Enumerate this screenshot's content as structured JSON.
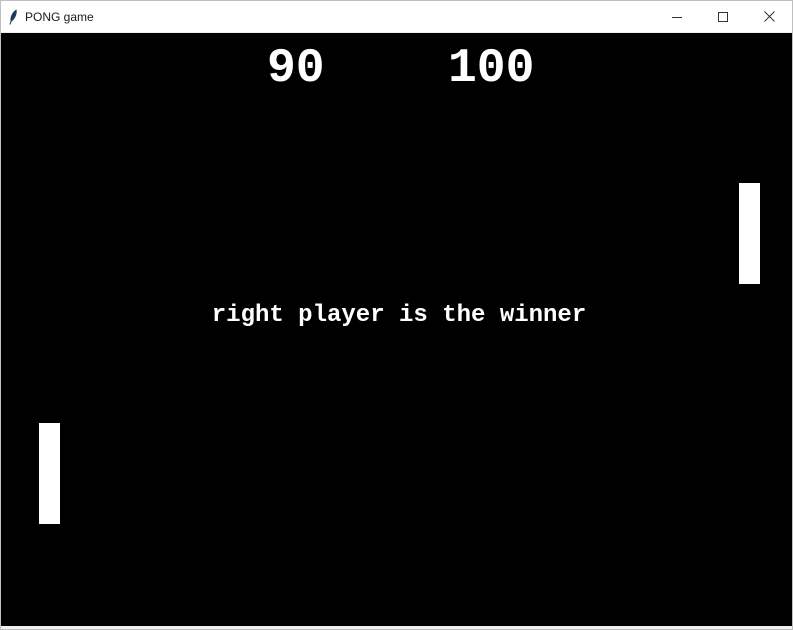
{
  "window": {
    "title": "PONG game",
    "app_icon": "feather-icon",
    "controls": [
      "minimize-icon",
      "maximize-icon",
      "close-icon"
    ]
  },
  "game": {
    "background_color": "#000000",
    "foreground_color": "#ffffff",
    "score_left": "90",
    "score_right": "100",
    "message": "right player is the winner"
  }
}
